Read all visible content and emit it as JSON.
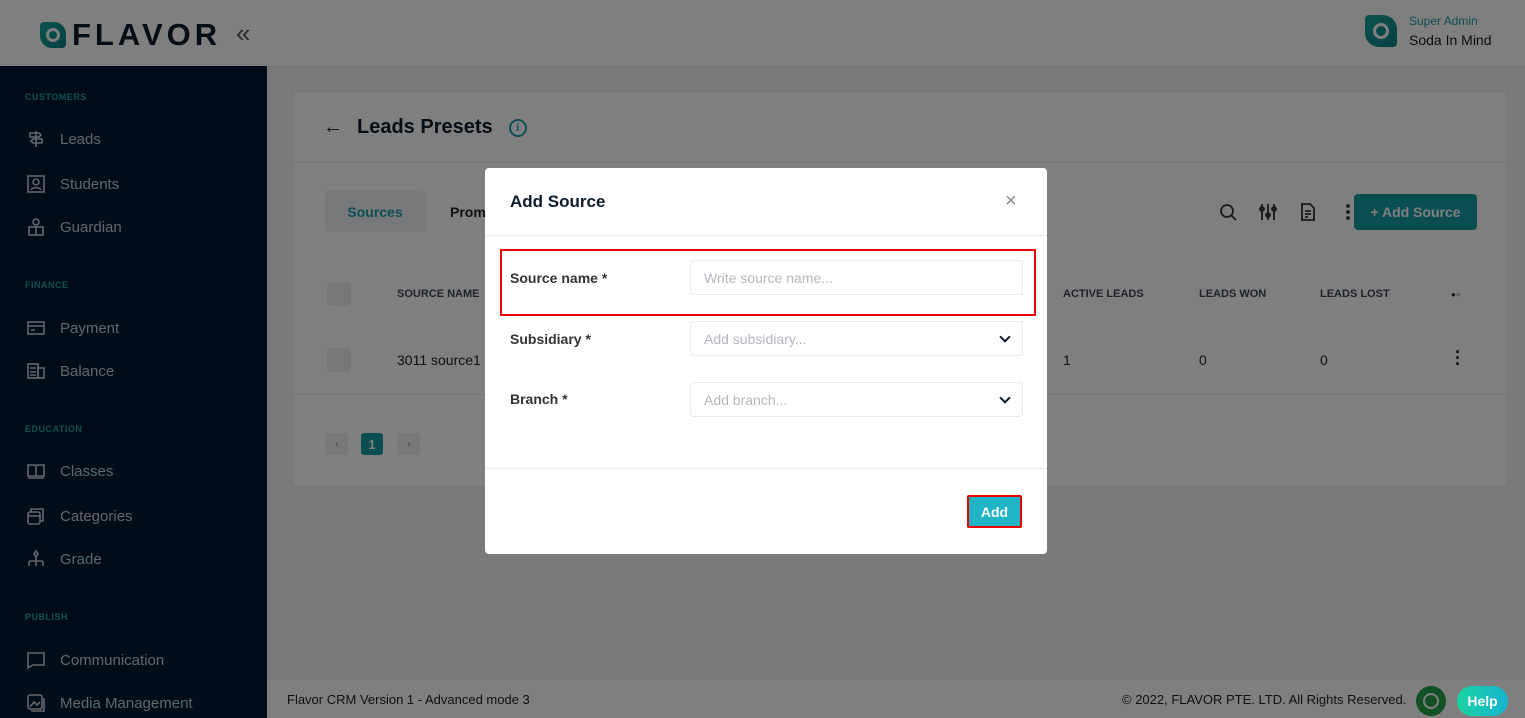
{
  "header": {
    "logo_text": "FLAVOR",
    "user_role": "Super Admin",
    "user_name": "Soda In Mind"
  },
  "sidebar": {
    "sections": [
      {
        "label": "CUSTOMERS",
        "items": [
          {
            "label": "Leads",
            "icon": "signpost-icon"
          },
          {
            "label": "Students",
            "icon": "student-icon"
          },
          {
            "label": "Guardian",
            "icon": "guardian-icon"
          }
        ]
      },
      {
        "label": "FINANCE",
        "items": [
          {
            "label": "Payment",
            "icon": "card-icon"
          },
          {
            "label": "Balance",
            "icon": "balance-icon"
          }
        ]
      },
      {
        "label": "EDUCATION",
        "items": [
          {
            "label": "Classes",
            "icon": "book-icon"
          },
          {
            "label": "Categories",
            "icon": "categories-icon"
          },
          {
            "label": "Grade",
            "icon": "grade-icon"
          }
        ]
      },
      {
        "label": "PUBLISH",
        "items": [
          {
            "label": "Communication",
            "icon": "chat-icon"
          },
          {
            "label": "Media Management",
            "icon": "media-icon"
          }
        ]
      }
    ]
  },
  "page": {
    "title": "Leads Presets",
    "tabs": [
      {
        "label": "Sources",
        "active": true
      },
      {
        "label": "Prom"
      }
    ],
    "add_button": "+ Add Source",
    "table": {
      "headers": [
        "SOURCE NAME",
        "ACTIVE LEADS",
        "LEADS WON",
        "LEADS LOST"
      ],
      "rows": [
        {
          "source_name": "3011 source1",
          "active_leads": "1",
          "leads_won": "0",
          "leads_lost": "0"
        }
      ]
    },
    "pagination": {
      "current": "1",
      "prev": "‹",
      "next": "›"
    }
  },
  "footer": {
    "version": "Flavor CRM Version 1 - Advanced mode 3",
    "copyright": "© 2022, FLAVOR PTE. LTD. All Rights Reserved.",
    "help": "Help"
  },
  "dialog": {
    "title": "Add Source",
    "close": "×",
    "fields": [
      {
        "label": "Source name *",
        "placeholder": "Write source name..."
      },
      {
        "label": "Subsidiary *",
        "placeholder": "Add subsidiary..."
      },
      {
        "label": "Branch *",
        "placeholder": "Add branch..."
      }
    ],
    "submit": "Add"
  },
  "colors": {
    "accent": "#169ca5",
    "sidebar": "#011a33",
    "highlight": "#e00000"
  }
}
